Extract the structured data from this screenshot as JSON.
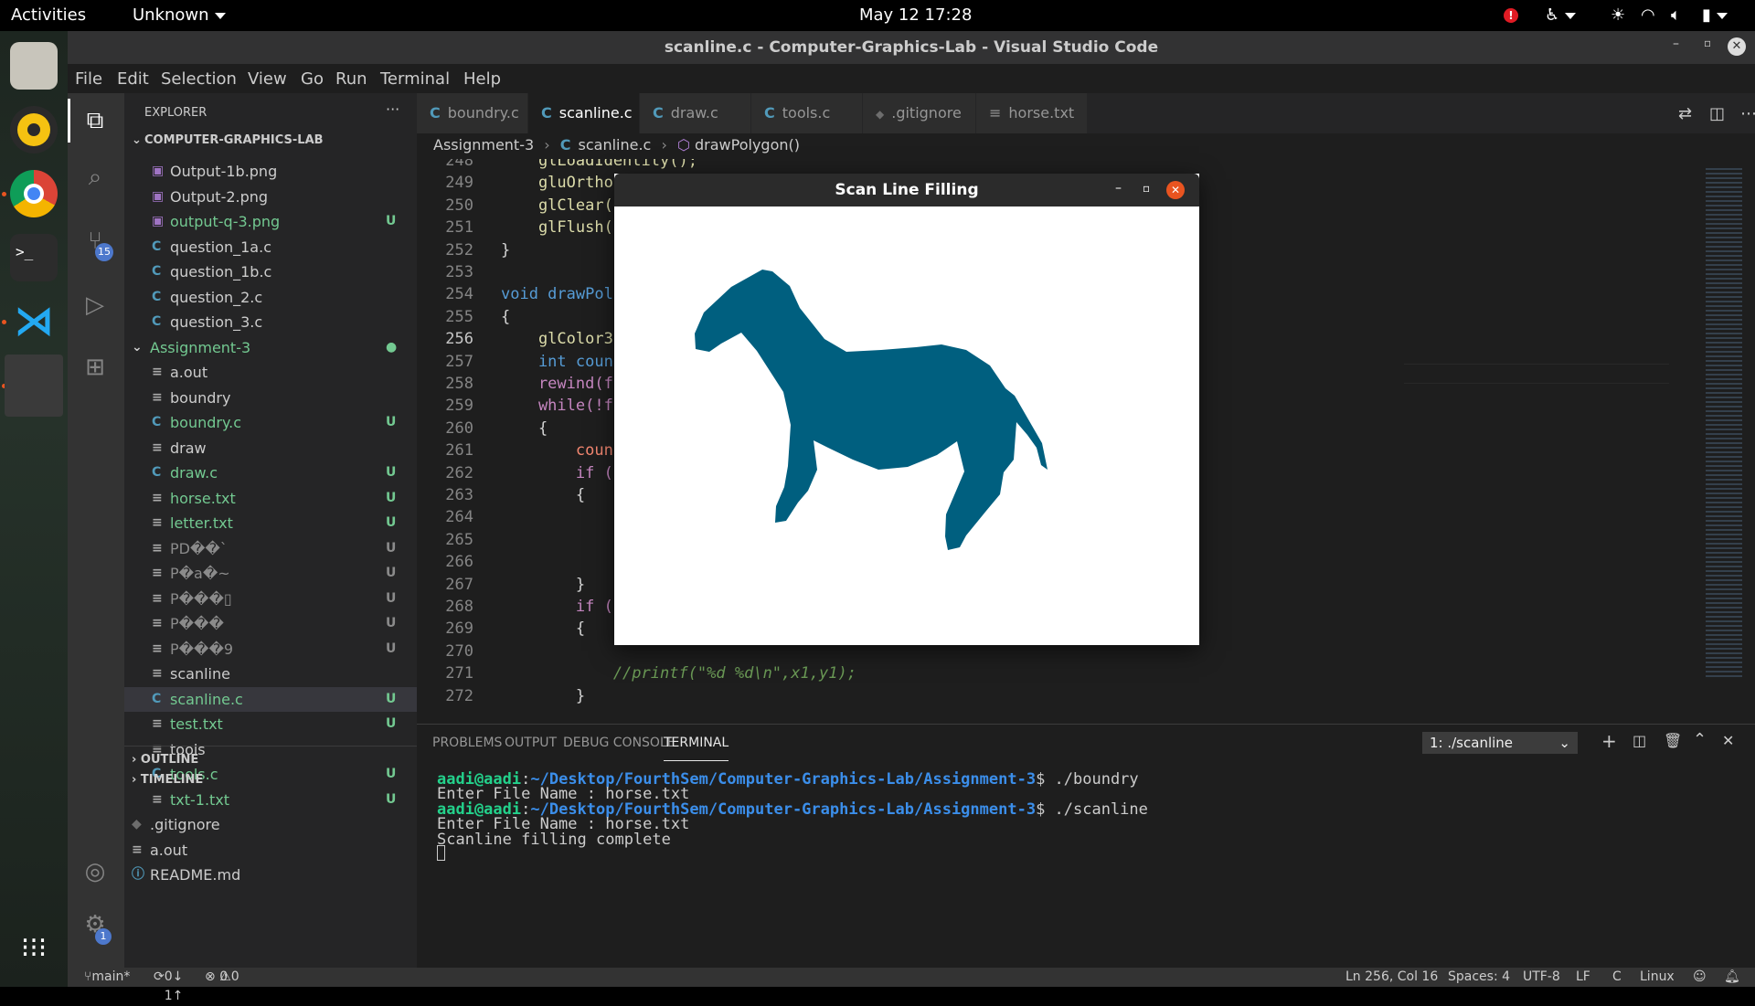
{
  "topbar": {
    "activities": "Activities",
    "app_menu": "Unknown",
    "clock": "May 12  17:28"
  },
  "window_title": "scanline.c - Computer-Graphics-Lab - Visual Studio Code",
  "menu": [
    "File",
    "Edit",
    "Selection",
    "View",
    "Go",
    "Run",
    "Terminal",
    "Help"
  ],
  "activity_badges": {
    "scm": "15",
    "settings": "1"
  },
  "explorer": {
    "header": "EXPLORER",
    "more": "···",
    "root": "COMPUTER-GRAPHICS-LAB",
    "items": [
      {
        "name": "Output-1b.png",
        "icon": "img",
        "status": "",
        "color": "#cccccc",
        "indent": 1
      },
      {
        "name": "Output-2.png",
        "icon": "img",
        "status": "",
        "color": "#cccccc",
        "indent": 1
      },
      {
        "name": "output-q-3.png",
        "icon": "img",
        "status": "U",
        "color": "#73c991",
        "indent": 1
      },
      {
        "name": "question_1a.c",
        "icon": "c",
        "status": "",
        "color": "#cccccc",
        "indent": 1
      },
      {
        "name": "question_1b.c",
        "icon": "c",
        "status": "",
        "color": "#cccccc",
        "indent": 1
      },
      {
        "name": "question_2.c",
        "icon": "c",
        "status": "",
        "color": "#cccccc",
        "indent": 1
      },
      {
        "name": "question_3.c",
        "icon": "c",
        "status": "",
        "color": "#cccccc",
        "indent": 1
      },
      {
        "name": "Assignment-3",
        "icon": "folder",
        "status": "●",
        "color": "#73c991",
        "indent": 0
      },
      {
        "name": "a.out",
        "icon": "txt",
        "status": "",
        "color": "#cccccc",
        "indent": 1
      },
      {
        "name": "boundry",
        "icon": "txt",
        "status": "",
        "color": "#cccccc",
        "indent": 1
      },
      {
        "name": "boundry.c",
        "icon": "c",
        "status": "U",
        "color": "#73c991",
        "indent": 1
      },
      {
        "name": "draw",
        "icon": "txt",
        "status": "",
        "color": "#cccccc",
        "indent": 1
      },
      {
        "name": "draw.c",
        "icon": "c",
        "status": "U",
        "color": "#73c991",
        "indent": 1
      },
      {
        "name": "horse.txt",
        "icon": "txt",
        "status": "U",
        "color": "#73c991",
        "indent": 1
      },
      {
        "name": "letter.txt",
        "icon": "txt",
        "status": "U",
        "color": "#73c991",
        "indent": 1
      },
      {
        "name": "PD��`",
        "icon": "txt",
        "status": "U",
        "color": "#8b8b8b",
        "indent": 1
      },
      {
        "name": "P�a�~",
        "icon": "txt",
        "status": "U",
        "color": "#8b8b8b",
        "indent": 1
      },
      {
        "name": "P���▯",
        "icon": "txt",
        "status": "U",
        "color": "#8b8b8b",
        "indent": 1
      },
      {
        "name": "P���",
        "icon": "txt",
        "status": "U",
        "color": "#8b8b8b",
        "indent": 1
      },
      {
        "name": "P���9",
        "icon": "txt",
        "status": "U",
        "color": "#8b8b8b",
        "indent": 1
      },
      {
        "name": "scanline",
        "icon": "txt",
        "status": "",
        "color": "#cccccc",
        "indent": 1
      },
      {
        "name": "scanline.c",
        "icon": "c",
        "status": "U",
        "color": "#73c991",
        "indent": 1,
        "selected": true
      },
      {
        "name": "test.txt",
        "icon": "txt",
        "status": "U",
        "color": "#73c991",
        "indent": 1
      },
      {
        "name": "tools",
        "icon": "txt",
        "status": "",
        "color": "#cccccc",
        "indent": 1
      },
      {
        "name": "tools.c",
        "icon": "c",
        "status": "U",
        "color": "#73c991",
        "indent": 1
      },
      {
        "name": "txt-1.txt",
        "icon": "txt",
        "status": "U",
        "color": "#73c991",
        "indent": 1
      },
      {
        "name": ".gitignore",
        "icon": "git",
        "status": "",
        "color": "#cccccc",
        "indent": 0
      },
      {
        "name": "a.out",
        "icon": "txt",
        "status": "",
        "color": "#cccccc",
        "indent": 0
      },
      {
        "name": "README.md",
        "icon": "info",
        "status": "",
        "color": "#cccccc",
        "indent": 0
      }
    ],
    "outline": "OUTLINE",
    "timeline": "TIMELINE"
  },
  "tabs": [
    {
      "label": "boundry.c",
      "icon": "C",
      "active": false
    },
    {
      "label": "scanline.c",
      "icon": "C",
      "active": true
    },
    {
      "label": "draw.c",
      "icon": "C",
      "active": false
    },
    {
      "label": "tools.c",
      "icon": "C",
      "active": false
    },
    {
      "label": ".gitignore",
      "icon": "◆",
      "active": false
    },
    {
      "label": "horse.txt",
      "icon": "≡",
      "active": false
    }
  ],
  "breadcrumb": {
    "folder": "Assignment-3",
    "file": "scanline.c",
    "symbol": "drawPolygon()"
  },
  "code": [
    {
      "n": "248",
      "t": "    glLoadIdentity();"
    },
    {
      "n": "249",
      "t": "    gluOrtho"
    },
    {
      "n": "250",
      "t": "    glClear("
    },
    {
      "n": "251",
      "t": "    glFlush("
    },
    {
      "n": "252",
      "t": "}"
    },
    {
      "n": "253",
      "t": ""
    },
    {
      "n": "254",
      "t": "void drawPol"
    },
    {
      "n": "255",
      "t": "{"
    },
    {
      "n": "256",
      "t": "    glColor3"
    },
    {
      "n": "257",
      "t": "    int coun"
    },
    {
      "n": "258",
      "t": "    rewind(f"
    },
    {
      "n": "259",
      "t": "    while(!f"
    },
    {
      "n": "260",
      "t": "    {"
    },
    {
      "n": "261",
      "t": "        coun"
    },
    {
      "n": "262",
      "t": "        if ("
    },
    {
      "n": "263",
      "t": "        {"
    },
    {
      "n": "264",
      "t": ""
    },
    {
      "n": "265",
      "t": ""
    },
    {
      "n": "266",
      "t": ""
    },
    {
      "n": "267",
      "t": "        }"
    },
    {
      "n": "268",
      "t": "        if ("
    },
    {
      "n": "269",
      "t": "        {"
    },
    {
      "n": "270",
      "t": ""
    },
    {
      "n": "271",
      "t": "            //printf(\"%d %d\\n\",x1,y1);"
    },
    {
      "n": "272",
      "t": "        }"
    }
  ],
  "scan_window": {
    "title": "Scan Line Filling",
    "fill": "#005f7f"
  },
  "panel": {
    "tabs": [
      "PROBLEMS",
      "OUTPUT",
      "DEBUG CONSOLE",
      "TERMINAL"
    ],
    "terminal_select": "1: ./scanline",
    "lines": [
      {
        "prompt": "aadi@aadi",
        "path": "~/Desktop/FourthSem/Computer-Graphics-Lab/Assignment-3",
        "cmd": "$ ./boundry"
      },
      {
        "text": "Enter File Name : horse.txt"
      },
      {
        "prompt": "aadi@aadi",
        "path": "~/Desktop/FourthSem/Computer-Graphics-Lab/Assignment-3",
        "cmd": "$ ./scanline"
      },
      {
        "text": "Enter File Name : horse.txt"
      },
      {
        "text": "Scanline filling complete"
      }
    ]
  },
  "status": {
    "branch": "main*",
    "sync": "0↓ 1↑",
    "problems": "0",
    "warnings": "0",
    "position": "Ln 256, Col 16",
    "spaces": "Spaces: 4",
    "encoding": "UTF-8",
    "eol": "LF",
    "lang": "C",
    "os": "Linux"
  }
}
